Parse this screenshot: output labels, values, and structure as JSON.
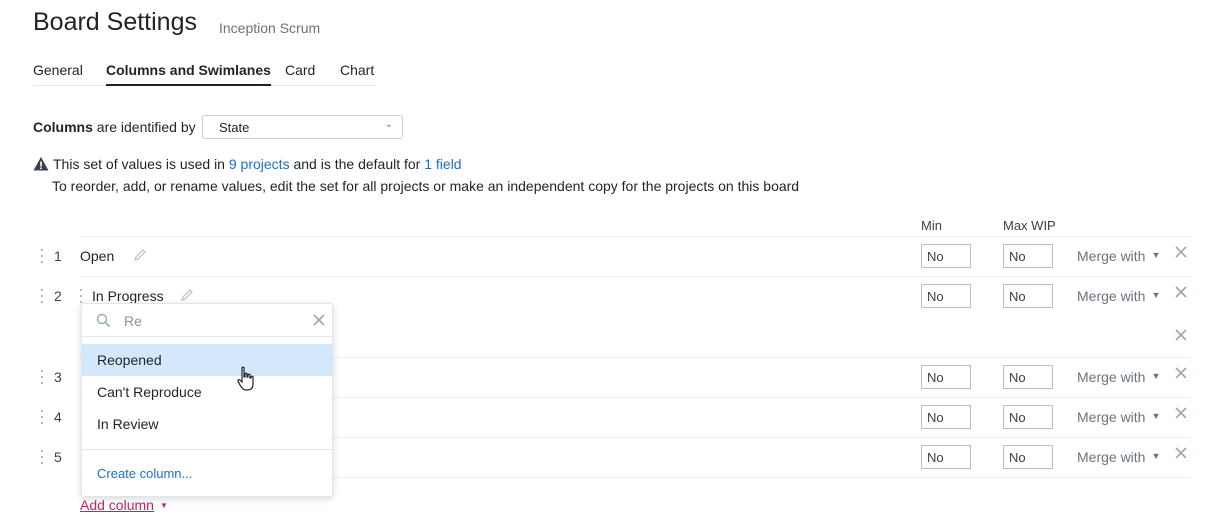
{
  "header": {
    "title": "Board Settings",
    "board_name": "Inception Scrum"
  },
  "tabs": [
    {
      "label": "General",
      "active": false
    },
    {
      "label": "Columns and Swimlanes",
      "active": true
    },
    {
      "label": "Card",
      "active": false
    },
    {
      "label": "Chart",
      "active": false
    }
  ],
  "identified": {
    "bold": "Columns",
    "rest": "are identified by",
    "selected": "State"
  },
  "notice": {
    "prefix": "This set of values is used in",
    "projects_link": "9 projects",
    "middle": "and is the default for",
    "field_link": "1 field",
    "line2": "To reorder, add, or rename values, edit the set for all projects or make an independent copy for the projects on this board"
  },
  "table_headers": {
    "min": "Min",
    "max_wip": "Max WIP"
  },
  "rows": [
    {
      "num": "1",
      "label": "Open",
      "min": "No",
      "max": "No",
      "merge": "Merge with"
    },
    {
      "num": "2",
      "label": "In Progress",
      "min": "No",
      "max": "No",
      "merge": "Merge with"
    },
    {
      "num": "3",
      "label": "",
      "min": "No",
      "max": "No",
      "merge": "Merge with"
    },
    {
      "num": "4",
      "label": "",
      "min": "No",
      "max": "No",
      "merge": "Merge with"
    },
    {
      "num": "5",
      "label": "",
      "min": "No",
      "max": "No",
      "merge": "Merge with"
    }
  ],
  "popup": {
    "search_value": "Re",
    "options": [
      "Reopened",
      "Can't Reproduce",
      "In Review"
    ],
    "highlighted": "Reopened",
    "create": "Create column..."
  },
  "add_column": "Add column",
  "colors": {
    "accent": "#1d6fc9",
    "highlight": "#d3e9fb",
    "add_link": "#cc1c6e"
  }
}
